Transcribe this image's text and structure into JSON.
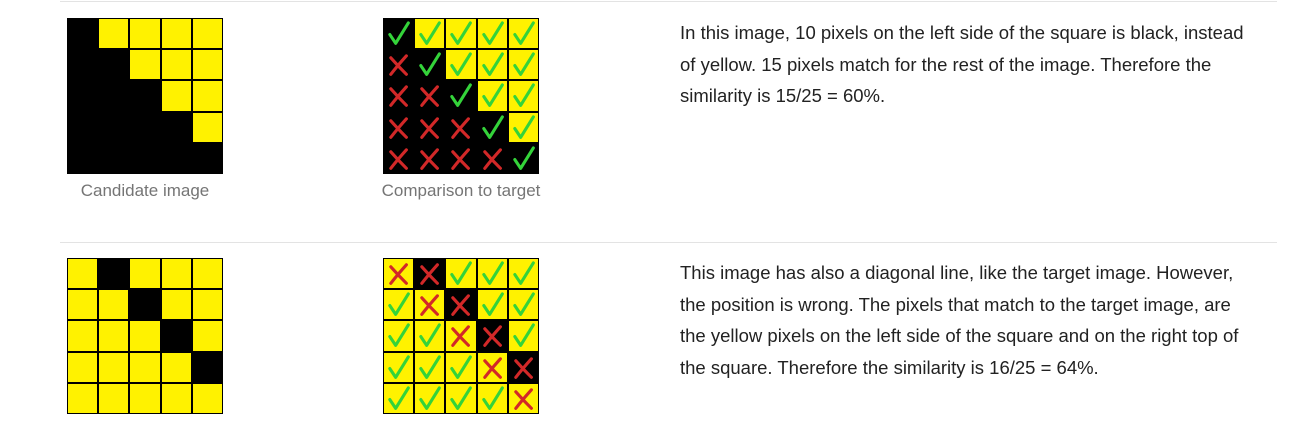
{
  "colors": {
    "yellow": "#fff200",
    "black": "#000000",
    "check": "#34d33a",
    "cross": "#d22828",
    "caption": "#757575",
    "text": "#222222"
  },
  "examples": [
    {
      "candidate": [
        [
          "b",
          "y",
          "y",
          "y",
          "y"
        ],
        [
          "b",
          "b",
          "y",
          "y",
          "y"
        ],
        [
          "b",
          "b",
          "b",
          "y",
          "y"
        ],
        [
          "b",
          "b",
          "b",
          "b",
          "y"
        ],
        [
          "b",
          "b",
          "b",
          "b",
          "b"
        ]
      ],
      "comparison": [
        [
          [
            "b",
            "check"
          ],
          [
            "y",
            "check"
          ],
          [
            "y",
            "check"
          ],
          [
            "y",
            "check"
          ],
          [
            "y",
            "check"
          ]
        ],
        [
          [
            "b",
            "cross"
          ],
          [
            "b",
            "check"
          ],
          [
            "y",
            "check"
          ],
          [
            "y",
            "check"
          ],
          [
            "y",
            "check"
          ]
        ],
        [
          [
            "b",
            "cross"
          ],
          [
            "b",
            "cross"
          ],
          [
            "b",
            "check"
          ],
          [
            "y",
            "check"
          ],
          [
            "y",
            "check"
          ]
        ],
        [
          [
            "b",
            "cross"
          ],
          [
            "b",
            "cross"
          ],
          [
            "b",
            "cross"
          ],
          [
            "b",
            "check"
          ],
          [
            "y",
            "check"
          ]
        ],
        [
          [
            "b",
            "cross"
          ],
          [
            "b",
            "cross"
          ],
          [
            "b",
            "cross"
          ],
          [
            "b",
            "cross"
          ],
          [
            "b",
            "check"
          ]
        ]
      ],
      "candidate_caption": "Candidate image",
      "comparison_caption": "Comparison to target",
      "description": "In this image, 10 pixels on the left side of the square is black, instead of yellow. 15 pixels match for the rest of the image. Therefore the similarity is 15/25 = 60%."
    },
    {
      "candidate": [
        [
          "y",
          "b",
          "y",
          "y",
          "y"
        ],
        [
          "y",
          "y",
          "b",
          "y",
          "y"
        ],
        [
          "y",
          "y",
          "y",
          "b",
          "y"
        ],
        [
          "y",
          "y",
          "y",
          "y",
          "b"
        ],
        [
          "y",
          "y",
          "y",
          "y",
          "y"
        ]
      ],
      "comparison": [
        [
          [
            "y",
            "cross"
          ],
          [
            "b",
            "cross"
          ],
          [
            "y",
            "check"
          ],
          [
            "y",
            "check"
          ],
          [
            "y",
            "check"
          ]
        ],
        [
          [
            "y",
            "check"
          ],
          [
            "y",
            "cross"
          ],
          [
            "b",
            "cross"
          ],
          [
            "y",
            "check"
          ],
          [
            "y",
            "check"
          ]
        ],
        [
          [
            "y",
            "check"
          ],
          [
            "y",
            "check"
          ],
          [
            "y",
            "cross"
          ],
          [
            "b",
            "cross"
          ],
          [
            "y",
            "check"
          ]
        ],
        [
          [
            "y",
            "check"
          ],
          [
            "y",
            "check"
          ],
          [
            "y",
            "check"
          ],
          [
            "y",
            "cross"
          ],
          [
            "b",
            "cross"
          ]
        ],
        [
          [
            "y",
            "check"
          ],
          [
            "y",
            "check"
          ],
          [
            "y",
            "check"
          ],
          [
            "y",
            "check"
          ],
          [
            "y",
            "cross"
          ]
        ]
      ],
      "candidate_caption": "",
      "comparison_caption": "",
      "description": "This image has also a diagonal line, like the target image. However, the position is wrong. The pixels that match to the target image, are the yellow pixels on the left side of the square and on the right top of the square. Therefore the similarity is 16/25 = 64%."
    }
  ]
}
